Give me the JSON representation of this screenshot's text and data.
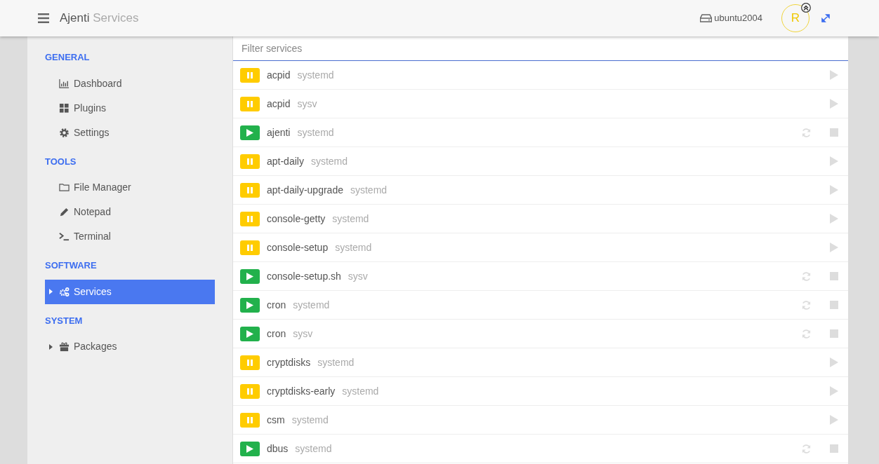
{
  "header": {
    "app": "Ajenti",
    "page": "Services",
    "host": "ubuntu2004",
    "avatar": "R"
  },
  "sidebar": {
    "sections": [
      {
        "title": "GENERAL",
        "items": [
          {
            "label": "Dashboard",
            "kind": "chart",
            "selected": false,
            "expandable": false
          },
          {
            "label": "Plugins",
            "kind": "grid",
            "selected": false,
            "expandable": false
          },
          {
            "label": "Settings",
            "kind": "gear",
            "selected": false,
            "expandable": false
          }
        ]
      },
      {
        "title": "TOOLS",
        "items": [
          {
            "label": "File Manager",
            "kind": "folder",
            "selected": false,
            "expandable": false
          },
          {
            "label": "Notepad",
            "kind": "pencil",
            "selected": false,
            "expandable": false
          },
          {
            "label": "Terminal",
            "kind": "terminal",
            "selected": false,
            "expandable": false
          }
        ]
      },
      {
        "title": "SOFTWARE",
        "items": [
          {
            "label": "Services",
            "kind": "cogs",
            "selected": true,
            "expandable": true
          }
        ]
      },
      {
        "title": "SYSTEM",
        "items": [
          {
            "label": "Packages",
            "kind": "gift",
            "selected": false,
            "expandable": true
          }
        ]
      }
    ]
  },
  "filter": {
    "placeholder": "Filter services"
  },
  "services": [
    {
      "name": "acpid",
      "type": "systemd",
      "running": false
    },
    {
      "name": "acpid",
      "type": "sysv",
      "running": false
    },
    {
      "name": "ajenti",
      "type": "systemd",
      "running": true
    },
    {
      "name": "apt-daily",
      "type": "systemd",
      "running": false
    },
    {
      "name": "apt-daily-upgrade",
      "type": "systemd",
      "running": false
    },
    {
      "name": "console-getty",
      "type": "systemd",
      "running": false
    },
    {
      "name": "console-setup",
      "type": "systemd",
      "running": false
    },
    {
      "name": "console-setup.sh",
      "type": "sysv",
      "running": true
    },
    {
      "name": "cron",
      "type": "systemd",
      "running": true
    },
    {
      "name": "cron",
      "type": "sysv",
      "running": true
    },
    {
      "name": "cryptdisks",
      "type": "systemd",
      "running": false
    },
    {
      "name": "cryptdisks-early",
      "type": "systemd",
      "running": false
    },
    {
      "name": "csm",
      "type": "systemd",
      "running": false
    },
    {
      "name": "dbus",
      "type": "systemd",
      "running": true
    }
  ]
}
